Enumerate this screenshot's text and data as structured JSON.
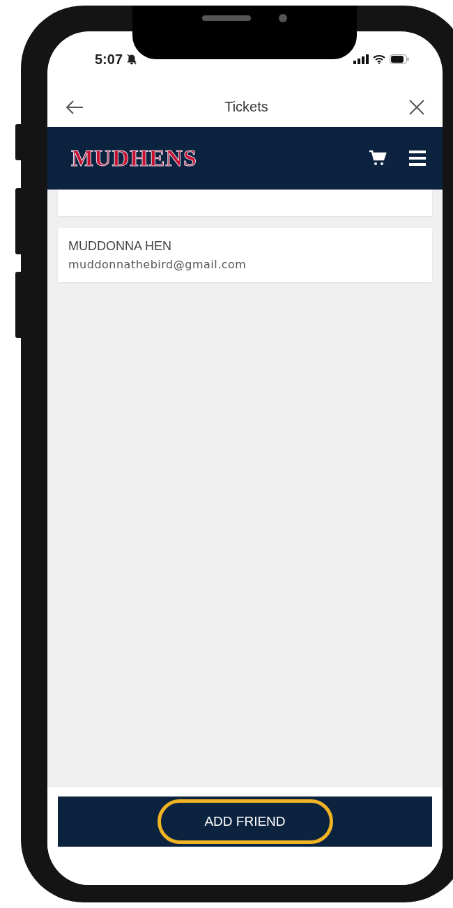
{
  "status_bar": {
    "time": "5:07"
  },
  "title_bar": {
    "title": "Tickets"
  },
  "header": {
    "logo": "MUDHENS"
  },
  "friends": [
    {
      "name": "MUDDONNA HEN",
      "email": "muddonnathebird@gmail.com"
    }
  ],
  "footer": {
    "button": {
      "label": "ADD FRIEND",
      "highlighted": true
    }
  }
}
